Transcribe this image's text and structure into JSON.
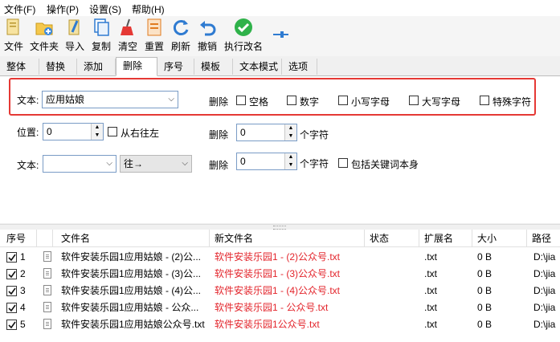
{
  "menu": [
    "文件(F)",
    "操作(P)",
    "设置(S)",
    "帮助(H)"
  ],
  "toolbar": [
    "文件",
    "文件夹",
    "导入",
    "复制",
    "清空",
    "重置",
    "刷新",
    "撤销",
    "执行改名"
  ],
  "tabs": [
    "整体",
    "替换",
    "添加",
    "删除",
    "序号",
    "模板",
    "文本模式",
    "选项"
  ],
  "panel": {
    "text_label": "文本:",
    "text_value": "应用姑娘",
    "delete_label": "删除",
    "options": [
      "空格",
      "数字",
      "小写字母",
      "大写字母",
      "特殊字符"
    ],
    "position_label": "位置:",
    "position_value": "0",
    "rtl_label": "从右往左",
    "delete2_label": "删除",
    "delete2_value": "0",
    "chars_label": "个字符",
    "text2_label": "文本:",
    "text2_value": "",
    "direction_value": "往→",
    "delete3_label": "删除",
    "delete3_value": "0",
    "chars2_label": "个字符",
    "include_label": "包括关键词本身"
  },
  "table": {
    "headers": [
      "序号",
      "文件名",
      "新文件名",
      "状态",
      "扩展名",
      "大小",
      "路径"
    ],
    "rows": [
      {
        "no": "1",
        "name": "软件安装乐园1应用姑娘 - (2)公...",
        "new": "软件安装乐园1 - (2)公众号.txt",
        "status": "",
        "ext": ".txt",
        "size": "0 B",
        "path": "D:\\jia"
      },
      {
        "no": "2",
        "name": "软件安装乐园1应用姑娘 - (3)公...",
        "new": "软件安装乐园1 - (3)公众号.txt",
        "status": "",
        "ext": ".txt",
        "size": "0 B",
        "path": "D:\\jia"
      },
      {
        "no": "3",
        "name": "软件安装乐园1应用姑娘 - (4)公...",
        "new": "软件安装乐园1 - (4)公众号.txt",
        "status": "",
        "ext": ".txt",
        "size": "0 B",
        "path": "D:\\jia"
      },
      {
        "no": "4",
        "name": "软件安装乐园1应用姑娘 - 公众...",
        "new": "软件安装乐园1 - 公众号.txt",
        "status": "",
        "ext": ".txt",
        "size": "0 B",
        "path": "D:\\jia"
      },
      {
        "no": "5",
        "name": "软件安装乐园1应用姑娘公众号.txt",
        "new": "软件安装乐园1公众号.txt",
        "status": "",
        "ext": ".txt",
        "size": "0 B",
        "path": "D:\\jia"
      }
    ]
  }
}
